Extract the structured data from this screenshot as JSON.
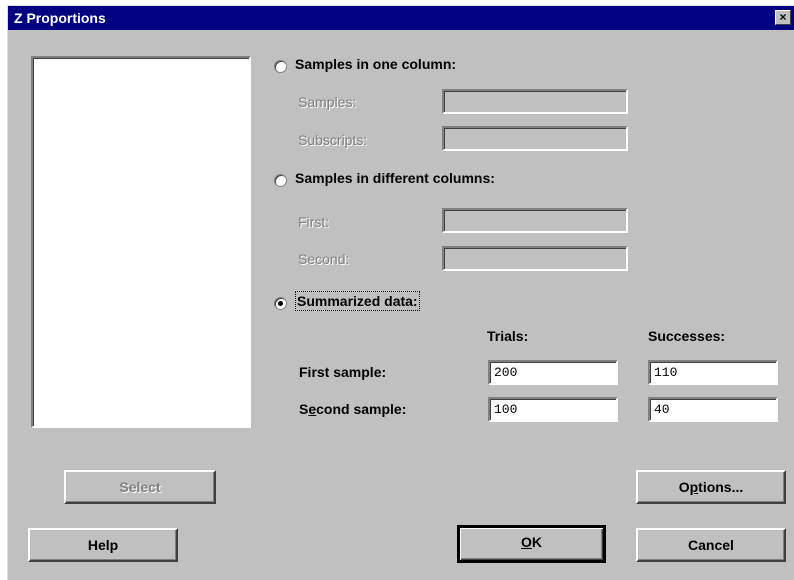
{
  "window": {
    "title": "Z Proportions",
    "close_glyph": "×"
  },
  "options": {
    "one_column": {
      "label": "Samples in one column:",
      "samples_label": "Samples:",
      "subscripts_label": "Subscripts:",
      "samples_value": "",
      "subscripts_value": ""
    },
    "diff_columns": {
      "label": "Samples in different columns:",
      "first_label": "First:",
      "second_label": "Second:",
      "first_value": "",
      "second_value": ""
    },
    "summarized": {
      "label": "Summarized data:",
      "selected": true
    }
  },
  "summary_table": {
    "trials_header": "Trials:",
    "successes_header": "Successes:",
    "rows": [
      {
        "label_pre": "First sample:",
        "label_ul": "",
        "label_post": "",
        "trials": "200",
        "successes": "110"
      },
      {
        "label_pre": "S",
        "label_ul": "e",
        "label_post": "cond sample:",
        "trials": "100",
        "successes": "40"
      }
    ]
  },
  "buttons": {
    "select": "Select",
    "options_pre": "O",
    "options_ul": "p",
    "options_post": "tions...",
    "help": "Help",
    "ok_ul": "O",
    "ok_post": "K",
    "cancel": "Cancel"
  }
}
